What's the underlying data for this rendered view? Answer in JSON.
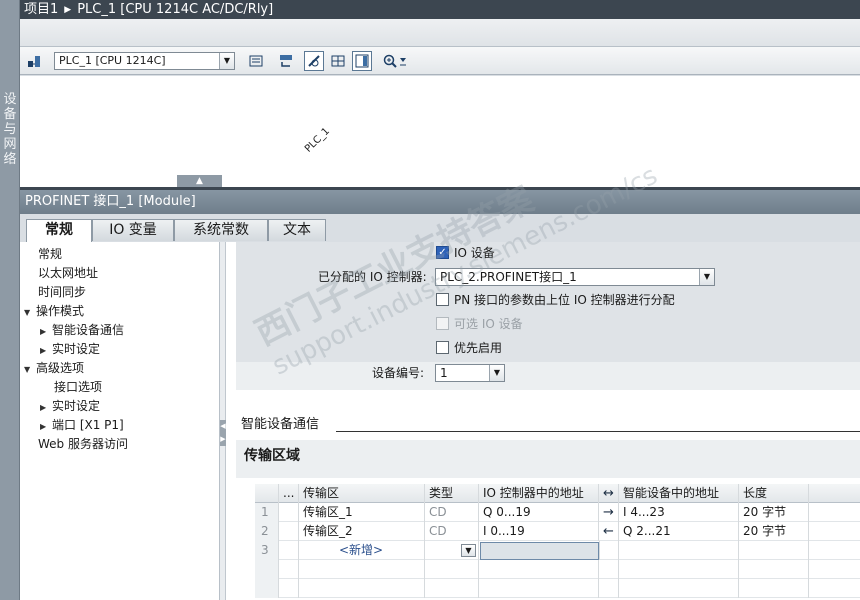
{
  "sidebar_strip": {
    "label": "设备与网络"
  },
  "title_bar": {
    "project": "项目1",
    "device": "PLC_1 [CPU 1214C AC/DC/Rly]"
  },
  "toolbar": {
    "device_select": "PLC_1 [CPU 1214C]"
  },
  "canvas": {
    "plc_label": "PLC_1"
  },
  "inspector": {
    "title": "PROFINET 接口_1 [Module]"
  },
  "tabs": [
    {
      "label": "常规"
    },
    {
      "label": "IO 变量"
    },
    {
      "label": "系统常数"
    },
    {
      "label": "文本"
    }
  ],
  "nav": {
    "items": [
      {
        "label": "常规"
      },
      {
        "label": "以太网地址"
      },
      {
        "label": "时间同步"
      },
      {
        "label": "操作模式"
      },
      {
        "label": "智能设备通信"
      },
      {
        "label": "实时设定"
      },
      {
        "label": "高级选项"
      },
      {
        "label": "接口选项"
      },
      {
        "label": "实时设定"
      },
      {
        "label": "端口 [X1 P1]"
      },
      {
        "label": "Web 服务器访问"
      }
    ]
  },
  "operation": {
    "io_device_label": "IO 设备",
    "assigned_controller_label": "已分配的 IO 控制器:",
    "assigned_controller_value": "PLC_2.PROFINET接口_1",
    "pn_param_label": "PN 接口的参数由上位 IO 控制器进行分配",
    "optional_io_label": "可选 IO 设备",
    "priority_startup_label": "优先启用",
    "device_number_label": "设备编号:",
    "device_number_value": "1"
  },
  "section": {
    "title": "智能设备通信",
    "subtitle": "传输区域"
  },
  "table": {
    "headers": {
      "dots": "...",
      "area": "传输区",
      "type": "类型",
      "controller_addr": "IO 控制器中的地址",
      "device_addr": "智能设备中的地址",
      "length": "长度"
    },
    "rows": [
      {
        "num": "1",
        "area": "传输区_1",
        "type": "CD",
        "controller_addr": "Q 0...19",
        "direction": "→",
        "device_addr": "I 4...23",
        "length": "20 字节"
      },
      {
        "num": "2",
        "area": "传输区_2",
        "type": "CD",
        "controller_addr": "I 0...19",
        "direction": "←",
        "device_addr": "Q 2...21",
        "length": "20 字节"
      }
    ],
    "new_row": {
      "num": "3",
      "label": "<新增>"
    }
  },
  "watermark": {
    "line1": "西门子工业支持答案",
    "line2": "support.industry.siemens.com/cs"
  }
}
